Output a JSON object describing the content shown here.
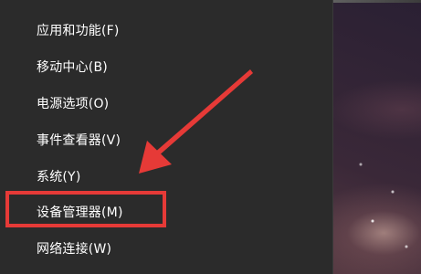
{
  "context_menu": {
    "items": [
      {
        "label": "应用和功能(F)"
      },
      {
        "label": "移动中心(B)"
      },
      {
        "label": "电源选项(O)"
      },
      {
        "label": "事件查看器(V)"
      },
      {
        "label": "系统(Y)"
      },
      {
        "label": "设备管理器(M)"
      },
      {
        "label": "网络连接(W)"
      }
    ],
    "highlighted_item": "设备管理器(M)"
  },
  "annotation": {
    "color": "#e63a37",
    "arrow_icon": "red-arrow-icon"
  }
}
